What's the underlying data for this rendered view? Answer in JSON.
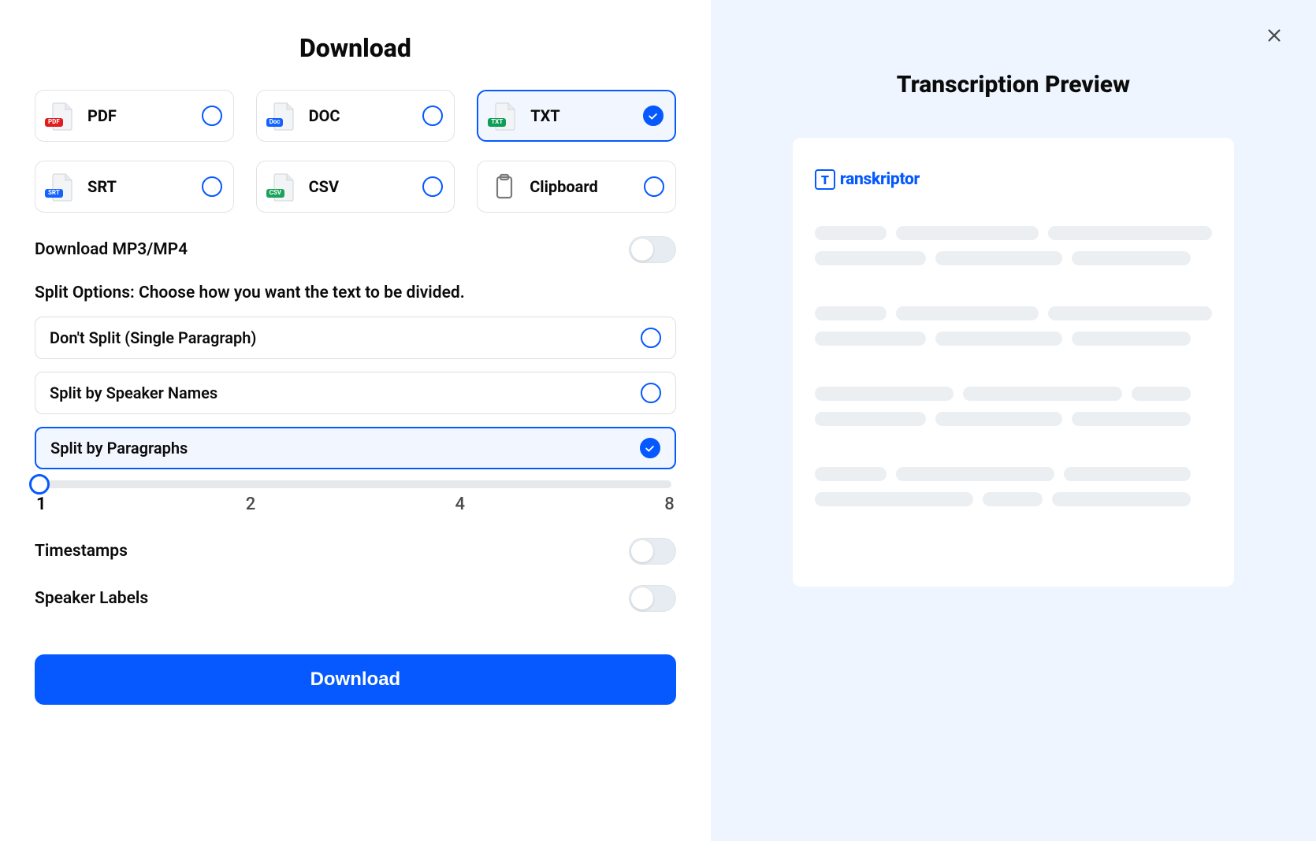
{
  "header": {
    "title": "Download"
  },
  "formats": [
    {
      "label": "PDF",
      "tag": "PDF",
      "tag_color": "#e11d1d",
      "selected": false
    },
    {
      "label": "DOC",
      "tag": "Doc",
      "tag_color": "#1463ff",
      "selected": false
    },
    {
      "label": "TXT",
      "tag": "TXT",
      "tag_color": "#0f9d58",
      "selected": true
    },
    {
      "label": "SRT",
      "tag": "SRT",
      "tag_color": "#1463ff",
      "selected": false
    },
    {
      "label": "CSV",
      "tag": "CSV",
      "tag_color": "#1aa35a",
      "selected": false
    },
    {
      "label": "Clipboard",
      "tag": "",
      "tag_color": "",
      "selected": false,
      "clipboard": true
    }
  ],
  "toggles": {
    "download_media": {
      "label": "Download MP3/MP4",
      "on": false
    },
    "timestamps": {
      "label": "Timestamps",
      "on": false
    },
    "speaker_labels": {
      "label": "Speaker Labels",
      "on": false
    }
  },
  "split": {
    "section_label": "Split Options: Choose how you want the text to be divided.",
    "options": [
      {
        "label": "Don't Split (Single Paragraph)",
        "selected": false
      },
      {
        "label": "Split by Speaker Names",
        "selected": false
      },
      {
        "label": "Split by Paragraphs",
        "selected": true
      }
    ],
    "slider": {
      "value": 1,
      "ticks": [
        "1",
        "2",
        "4",
        "8"
      ]
    }
  },
  "primary_action": {
    "label": "Download"
  },
  "preview": {
    "title": "Transcription Preview",
    "brand": "ranskriptor",
    "brand_mark": "T"
  }
}
